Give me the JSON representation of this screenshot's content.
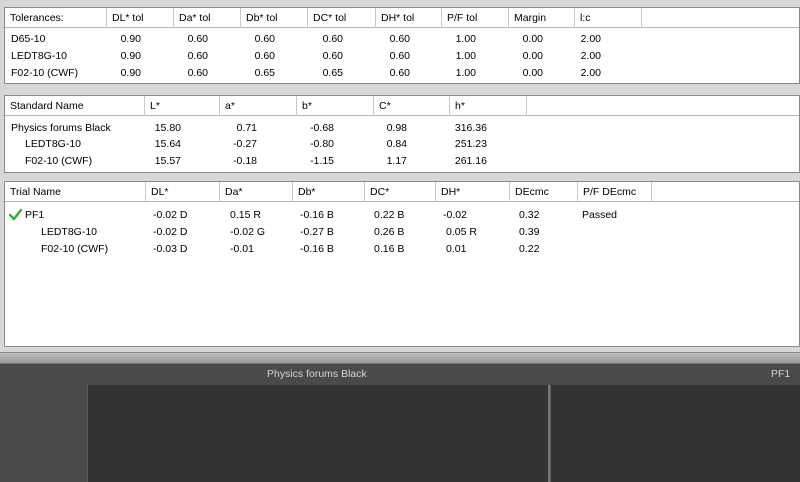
{
  "tolerances": {
    "headers": [
      "Tolerances:",
      "DL* tol",
      "Da* tol",
      "Db* tol",
      "DC* tol",
      "DH* tol",
      "P/F tol",
      "Margin",
      "l:c"
    ],
    "rows": [
      [
        "D65-10",
        "0.90",
        "0.60",
        "0.60",
        "0.60",
        "0.60",
        "1.00",
        "0.00",
        "2.00"
      ],
      [
        "LEDT8G-10",
        "0.90",
        "0.60",
        "0.60",
        "0.60",
        "0.60",
        "1.00",
        "0.00",
        "2.00"
      ],
      [
        "F02-10 (CWF)",
        "0.90",
        "0.60",
        "0.65",
        "0.65",
        "0.60",
        "1.00",
        "0.00",
        "2.00"
      ]
    ]
  },
  "standard": {
    "headers": [
      "Standard Name",
      "L*",
      "a*",
      "b*",
      "C*",
      "h*"
    ],
    "rows": [
      [
        "Physics forums Black",
        "15.80",
        "0.71",
        "-0.68",
        "0.98",
        "316.36"
      ],
      [
        "LEDT8G-10",
        "15.64",
        "-0.27",
        "-0.80",
        "0.84",
        "251.23"
      ],
      [
        "F02-10 (CWF)",
        "15.57",
        "-0.18",
        "-1.15",
        "1.17",
        "261.16"
      ]
    ]
  },
  "trial": {
    "headers": [
      "Trial Name",
      "DL*",
      "Da*",
      "Db*",
      "DC*",
      "DH*",
      "DEcmc",
      "P/F DEcmc"
    ],
    "rows": [
      [
        "PF1",
        "-0.02 D",
        "0.15 R",
        "-0.16 B",
        "0.22 B",
        "-0.02",
        "0.32",
        "Passed"
      ],
      [
        "LEDT8G-10",
        "-0.02 D",
        "-0.02 G",
        "-0.27 B",
        "0.26 B",
        "0.05 R",
        "0.39",
        ""
      ],
      [
        "F02-10 (CWF)",
        "-0.03 D",
        "-0.01",
        "-0.16 B",
        "0.16 B",
        "0.01",
        "0.22",
        ""
      ]
    ],
    "pass_icon": "check-icon",
    "pass_color": "#2fae2f"
  },
  "preview": {
    "standard_label": "Physics forums Black",
    "trial_label": "PF1",
    "swatch_color": "#333333"
  }
}
